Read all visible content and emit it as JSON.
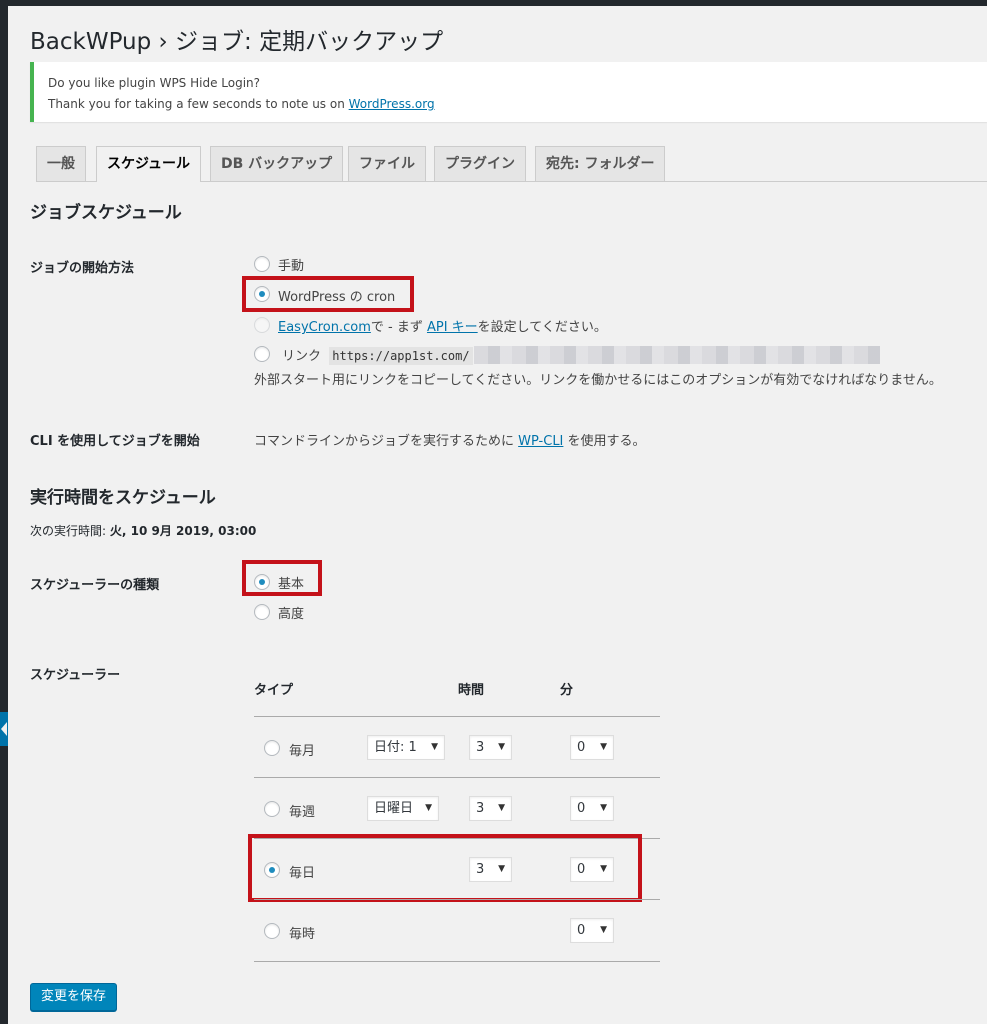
{
  "page": {
    "title": "BackWPup › ジョブ: 定期バックアップ"
  },
  "notice": {
    "line1": "Do you like plugin WPS Hide Login?",
    "line2_prefix": "Thank you for taking a few seconds to note us on ",
    "line2_link": "WordPress.org"
  },
  "tabs": [
    {
      "label": "一般",
      "active": false
    },
    {
      "label": "スケジュール",
      "active": true
    },
    {
      "label": "DB バックアップ",
      "active": false
    },
    {
      "label": "ファイル",
      "active": false
    },
    {
      "label": "プラグイン",
      "active": false
    },
    {
      "label": "宛先: フォルダー",
      "active": false
    }
  ],
  "job_schedule": {
    "heading": "ジョブスケジュール",
    "start_method_label": "ジョブの開始方法",
    "options": {
      "manual": "手動",
      "wpcron": "WordPress の cron",
      "easycron_link": "EasyCron.com",
      "easycron_mid": "で - まず ",
      "easycron_api_link": "API キー",
      "easycron_suffix": "を設定してください。",
      "link_label": "リンク",
      "link_url": "https://app1st.com/",
      "link_help": "外部スタート用にリンクをコピーしてください。リンクを働かせるにはこのオプションが有効でなければなりません。"
    },
    "selected": "wpcron",
    "cli_label": "CLI を使用してジョブを開始",
    "cli_prefix": "コマンドラインからジョブを実行するために ",
    "cli_link": "WP-CLI",
    "cli_suffix": " を使用する。"
  },
  "run_schedule": {
    "heading": "実行時間をスケジュール",
    "next_run_prefix": "次の実行時間: ",
    "next_run_value": "火, 10 9月 2019, 03:00",
    "type_label": "スケジューラーの種類",
    "type_basic": "基本",
    "type_advanced": "高度",
    "type_selected": "basic",
    "scheduler_label": "スケジューラー",
    "headers": {
      "type": "タイプ",
      "hour": "時間",
      "minute": "分"
    },
    "rows": [
      {
        "name": "毎月",
        "day_select": "日付: 1",
        "hour": "3",
        "minute": "0",
        "checked": false
      },
      {
        "name": "毎週",
        "day_select": "日曜日",
        "hour": "3",
        "minute": "0",
        "checked": false
      },
      {
        "name": "毎日",
        "hour": "3",
        "minute": "0",
        "checked": true
      },
      {
        "name": "毎時",
        "minute": "0",
        "checked": false
      }
    ]
  },
  "buttons": {
    "save": "変更を保存"
  },
  "colors": {
    "highlight": "#c4121a",
    "accent": "#0085ba",
    "notice_border": "#46b450"
  }
}
